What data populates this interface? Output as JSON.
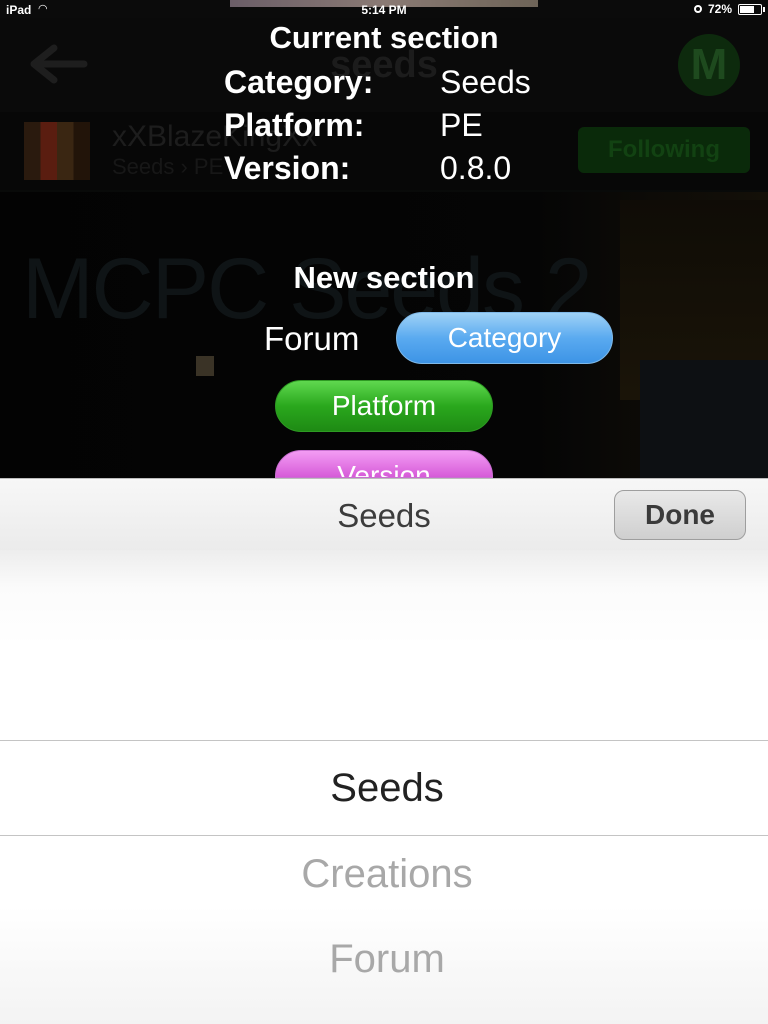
{
  "status_bar": {
    "device": "iPad",
    "time": "5:14 PM",
    "battery": "72%",
    "battery_level": 0.72
  },
  "background": {
    "title": "seeds",
    "avatar_letter": "M",
    "username": "xXBlazeKingXx",
    "breadcrumb": "Seeds › PE",
    "follow_label": "Following",
    "banner_text": "MCPC Seeds 2"
  },
  "current_section": {
    "heading": "Current section",
    "rows": [
      {
        "key": "Category:",
        "value": "Seeds"
      },
      {
        "key": "Platform:",
        "value": "PE"
      },
      {
        "key": "Version:",
        "value": "0.8.0"
      }
    ]
  },
  "new_section": {
    "heading": "New section",
    "forum_label": "Forum",
    "buttons": {
      "category": "Category",
      "platform": "Platform",
      "version": "Version"
    }
  },
  "picker": {
    "toolbar_title": "Seeds",
    "done_label": "Done",
    "options": [
      "Seeds",
      "Creations",
      "Forum"
    ],
    "selected": "Seeds"
  },
  "colors": {
    "category_button": "#5aaaf0",
    "platform_button": "#2aa81d",
    "version_button": "#d65bd8"
  }
}
